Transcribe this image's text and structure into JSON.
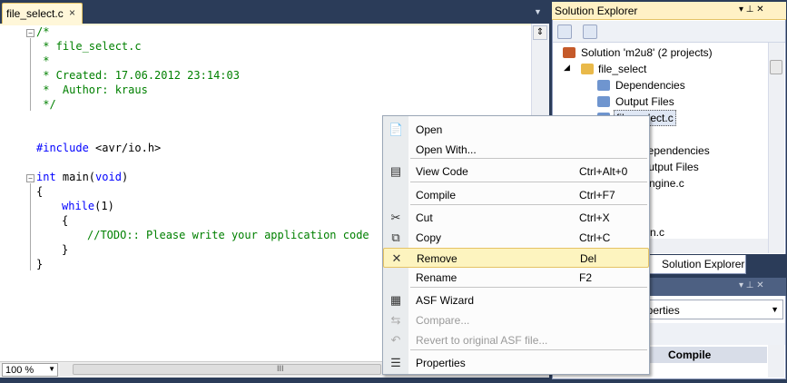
{
  "editor": {
    "tab_title": "file_select.c",
    "tab_close": "×",
    "dropdown_glyph": "▼",
    "split_glyph": "⇕",
    "lines": {
      "l1": "/*",
      "l2": " * file_select.c",
      "l3": " *",
      "l4": " * Created: 17.06.2012 23:14:03",
      "l5": " *  Author: kraus",
      "l6": " */",
      "l7_kw": "#include",
      "l7_rest": " <avr/io.h>",
      "l8_kw": "int",
      "l8_rest": " main(",
      "l8_kw2": "void",
      "l8_end": ")",
      "l9": "{",
      "l10_kw": "while",
      "l10_rest": "(1)",
      "l11": "{",
      "l12": "//TODO:: Please write your application code",
      "l13": "}",
      "l14": "}"
    },
    "zoom": "100 %",
    "zoom_arrow": "▼",
    "hscroll_grip": "III"
  },
  "solution_explorer": {
    "title": "Solution Explorer",
    "pin_glyph": "▾ ⊥ ✕",
    "items": {
      "solution": "Solution 'm2u8' (2 projects)",
      "project": "file_select",
      "dependencies": "Dependencies",
      "output_files": "Output Files",
      "selected_file": "file_select.c",
      "dependencies2": "Dependencies",
      "output_files2": "Output Files",
      "engine": "ngine.c",
      "partial": "n.c"
    },
    "tab_label": "Solution Explorer"
  },
  "properties": {
    "controls": "▾ ⊥ ✕",
    "combo_text": "operties",
    "combo_arrow": "▼",
    "grid_header": "Compile"
  },
  "context_menu": {
    "items": [
      {
        "label": "Open",
        "shortcut": "",
        "icon": "open-file-icon",
        "glyph": "📄",
        "disabled": false
      },
      {
        "label": "Open With...",
        "shortcut": "",
        "icon": "",
        "glyph": "",
        "disabled": false
      },
      {
        "label": "View Code",
        "shortcut": "Ctrl+Alt+0",
        "icon": "view-code-icon",
        "glyph": "▤",
        "disabled": false
      },
      {
        "label": "Compile",
        "shortcut": "Ctrl+F7",
        "icon": "",
        "glyph": "",
        "disabled": false
      },
      {
        "label": "Cut",
        "shortcut": "Ctrl+X",
        "icon": "scissors-icon",
        "glyph": "✂",
        "disabled": false
      },
      {
        "label": "Copy",
        "shortcut": "Ctrl+C",
        "icon": "copy-icon",
        "glyph": "⧉",
        "disabled": false
      },
      {
        "label": "Remove",
        "shortcut": "Del",
        "icon": "remove-x-icon",
        "glyph": "✕",
        "disabled": false,
        "highlighted": true
      },
      {
        "label": "Rename",
        "shortcut": "F2",
        "icon": "",
        "glyph": "",
        "disabled": false
      },
      {
        "label": "ASF Wizard",
        "shortcut": "",
        "icon": "asf-wizard-icon",
        "glyph": "▦",
        "disabled": false
      },
      {
        "label": "Compare...",
        "shortcut": "",
        "icon": "compare-icon",
        "glyph": "⇆",
        "disabled": true
      },
      {
        "label": "Revert to original ASF file...",
        "shortcut": "",
        "icon": "revert-icon",
        "glyph": "↶",
        "disabled": true
      },
      {
        "label": "Properties",
        "shortcut": "",
        "icon": "properties-icon",
        "glyph": "☰",
        "disabled": false
      }
    ]
  },
  "colors": {
    "chrome_dark": "#2b3c59",
    "tab_active": "#fff7d9",
    "highlight": "#fdf4bf",
    "comment": "#008000",
    "keyword": "#0000ff"
  }
}
